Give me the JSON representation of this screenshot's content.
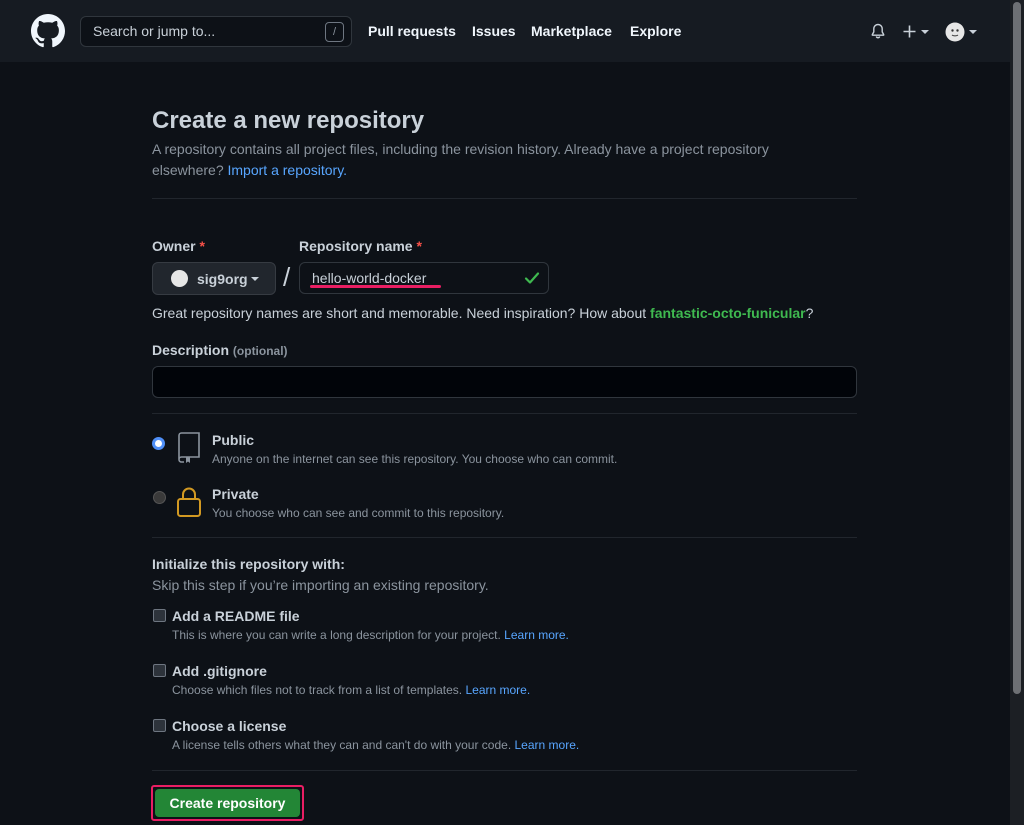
{
  "header": {
    "search_placeholder": "Search or jump to...",
    "search_shortcut": "/",
    "nav": [
      "Pull requests",
      "Issues",
      "Marketplace",
      "Explore"
    ]
  },
  "page": {
    "title": "Create a new repository",
    "subtitle": "A repository contains all project files, including the revision history. Already have a project repository elsewhere?",
    "import_link": "Import a repository."
  },
  "owner": {
    "label": "Owner",
    "required_mark": "*",
    "value": "sig9org"
  },
  "repo_name": {
    "label": "Repository name",
    "required_mark": "*",
    "value": "hello-world-docker"
  },
  "name_hint": {
    "text": "Great repository names are short and memorable. Need inspiration? How about",
    "suggestion": "fantastic-octo-funicular",
    "end": "?"
  },
  "description": {
    "label": "Description",
    "optional": "(optional)",
    "value": ""
  },
  "visibility": {
    "public": {
      "title": "Public",
      "desc": "Anyone on the internet can see this repository. You choose who can commit.",
      "selected": true
    },
    "private": {
      "title": "Private",
      "desc": "You choose who can see and commit to this repository.",
      "selected": false
    }
  },
  "init": {
    "title": "Initialize this repository with:",
    "subtitle": "Skip this step if you’re importing an existing repository.",
    "options": [
      {
        "label": "Add a README file",
        "desc": "This is where you can write a long description for your project.",
        "link": "Learn more."
      },
      {
        "label": "Add .gitignore",
        "desc": "Choose which files not to track from a list of templates.",
        "link": "Learn more."
      },
      {
        "label": "Choose a license",
        "desc": "A license tells others what they can and can't do with your code.",
        "link": "Learn more."
      }
    ]
  },
  "create_button": "Create repository",
  "colors": {
    "accent_link": "#58a6ff",
    "create_green": "#238636",
    "highlight_pink": "#e91e63",
    "suggestion_green": "#3fb950"
  }
}
